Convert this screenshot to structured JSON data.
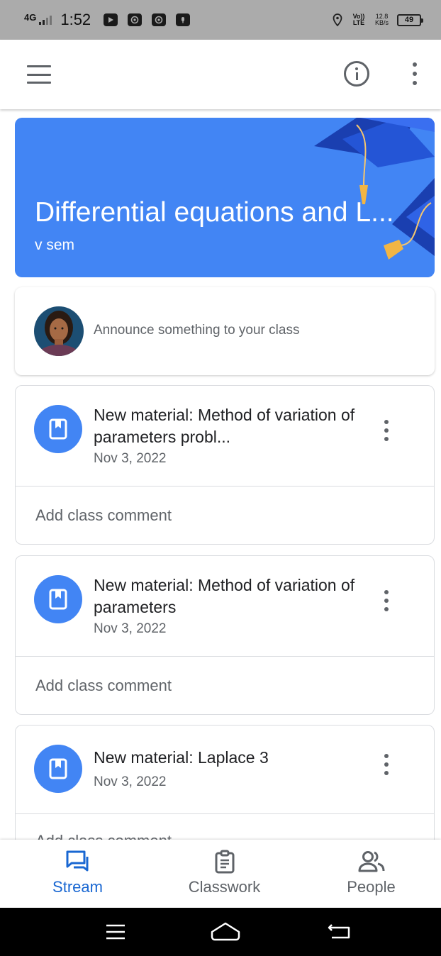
{
  "status_bar": {
    "network": "4G",
    "time": "1:52",
    "volte": "Vo)) LTE",
    "speed_value": "12.8",
    "speed_unit": "KB/s",
    "battery": "49"
  },
  "app_bar": {
    "menu_icon": "hamburger-menu-icon",
    "info_icon": "info-icon",
    "more_icon": "more-vert-icon"
  },
  "banner": {
    "title": "Differential equations and L...",
    "subtitle": "v sem",
    "color": "#4285f4"
  },
  "announce": {
    "placeholder": "Announce something to your class"
  },
  "posts": [
    {
      "title": "New material: Method of variation of parameters probl...",
      "date": "Nov 3, 2022",
      "comment": "Add class comment"
    },
    {
      "title": "New material: Method of variation of parameters",
      "date": "Nov 3, 2022",
      "comment": "Add class comment"
    },
    {
      "title": "New material: Laplace 3",
      "date": "Nov 3, 2022",
      "comment": "Add class comment"
    }
  ],
  "bottom_nav": {
    "items": [
      {
        "label": "Stream",
        "icon": "stream-icon",
        "active": true
      },
      {
        "label": "Classwork",
        "icon": "classwork-icon",
        "active": false
      },
      {
        "label": "People",
        "icon": "people-icon",
        "active": false
      }
    ],
    "active_color": "#1967d2"
  }
}
